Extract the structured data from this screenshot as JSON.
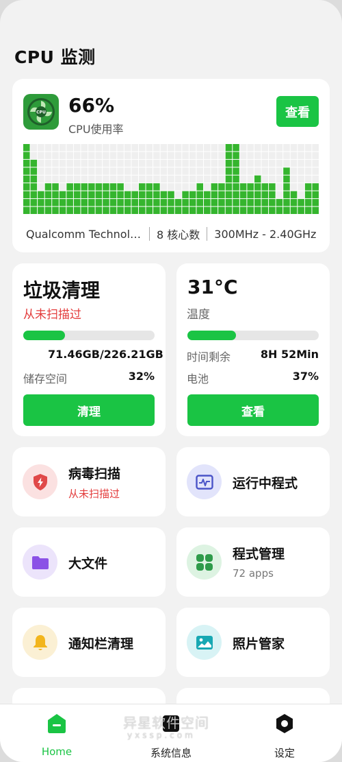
{
  "page": {
    "title": "CPU 监测"
  },
  "cpu": {
    "usage": "66%",
    "usage_label": "CPU使用率",
    "view_button": "查看",
    "model": "Qualcomm Technologies, Inc",
    "cores": "8 核心数",
    "freq": "300MHz - 2.40GHz",
    "usage_history": [
      9,
      7,
      3,
      4,
      4,
      3,
      4,
      4,
      4,
      4,
      4,
      4,
      4,
      4,
      3,
      3,
      4,
      4,
      4,
      3,
      3,
      2,
      3,
      3,
      4,
      3,
      4,
      4,
      9,
      9,
      4,
      4,
      5,
      4,
      4,
      2,
      6,
      3,
      2,
      4,
      4
    ],
    "grid_rows": 9,
    "bar_color": "#35b52e",
    "empty_color": "#efefef"
  },
  "clean": {
    "title": "垃圾清理",
    "status": "从未扫描过",
    "storage_used": "71.46GB/226.21GB",
    "storage_label": "储存空间",
    "storage_pct": "32%",
    "storage_fraction": 0.32,
    "button": "清理"
  },
  "temp": {
    "title": "31°C",
    "label": "温度",
    "fraction": 0.37,
    "time_label": "时间剩余",
    "time_value": "8H 52Min",
    "battery_label": "电池",
    "battery_value": "37%",
    "button": "查看"
  },
  "tiles": {
    "virus": {
      "title": "病毒扫描",
      "sub": "从未扫描过"
    },
    "running": {
      "title": "运行中程式"
    },
    "bigfile": {
      "title": "大文件"
    },
    "apps": {
      "title": "程式管理",
      "sub": "72 apps"
    },
    "notify": {
      "title": "通知栏清理"
    },
    "photo": {
      "title": "照片管家"
    }
  },
  "nav": {
    "home": "Home",
    "sysinfo": "系统信息",
    "settings": "设定"
  },
  "watermark": {
    "line1": "异星软件空间",
    "line2": "yxssp.com"
  },
  "colors": {
    "accent": "#1ac444",
    "danger": "#e33b3b",
    "background": "#f2f2f2"
  },
  "icons": {
    "cpu": "cpu-fan-icon",
    "virus": "shield-bolt-icon",
    "running": "pulse-window-icon",
    "bigfile": "folder-icon",
    "apps": "grid-icon",
    "notify": "bell-icon",
    "photo": "image-icon",
    "home": "home-icon",
    "sysinfo": "device-icon",
    "settings": "hexagon-gear-icon"
  }
}
